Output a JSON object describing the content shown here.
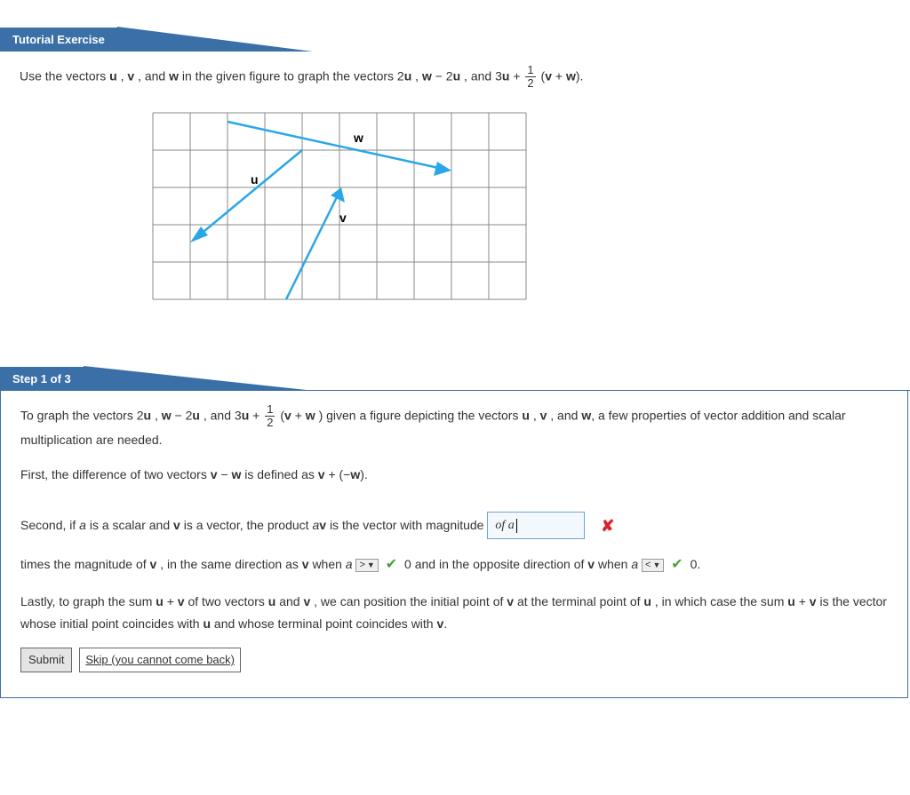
{
  "exercise": {
    "tab_label": "Tutorial Exercise",
    "prompt_pre": "Use the vectors  ",
    "u": "u",
    "v": "v",
    "w": "w",
    "prompt_mid1": ",   ",
    "prompt_mid2": ",  and  ",
    "prompt_mid3": "  in the given figure to graph the vectors  2",
    "prompt_mid4": ",   ",
    "prompt_mid5": " − 2",
    "prompt_mid6": ",  and  3",
    "prompt_mid7": " + ",
    "frac_num": "1",
    "frac_den": "2",
    "prompt_mid8": "(",
    "prompt_mid9": " + ",
    "prompt_end": ")."
  },
  "figure": {
    "label_u": "u",
    "label_v": "v",
    "label_w": "w"
  },
  "step": {
    "tab_label": "Step 1 of 3",
    "p1a": "To graph the vectors  2",
    "p1b": ",   ",
    "p1c": " − 2",
    "p1d": ",  and  3",
    "p1e": " + ",
    "p1f": "(",
    "p1g": " + ",
    "p1h": ")  given a figure depicting the vectors  ",
    "p1i": ",   ",
    "p1j": ",  and ",
    "p1k": ",  a few properties of vector addition and scalar multiplication are needed.",
    "p2a": "First, the difference of two vectors  ",
    "p2b": " − ",
    "p2c": "  is defined as  ",
    "p2d": " + (−",
    "p2e": ").",
    "p3a": "Second, if ",
    "p3a_it": "a",
    "p3b": " is a scalar and  ",
    "p3c": "  is a vector, the product  ",
    "p3c_it": "a",
    "p3d": "  is the vector with magnitude",
    "answer_text": "of a",
    "p4a": "times the magnitude of  ",
    "p4b": ",  in the same direction as  ",
    "p4c": "  when  ",
    "p4c_it": "a",
    "select1": ">",
    "p4d": "0 and in the opposite direction of ",
    "p4e": "  when  ",
    "p4e_it": "a",
    "select2": "<",
    "p4f": "0.",
    "p5a": "Lastly, to graph the sum  ",
    "p5b": " + ",
    "p5c": "  of two vectors  ",
    "p5d": "  and  ",
    "p5e": ",  we can position the initial point of  ",
    "p5f": "  at the terminal point of  ",
    "p5g": ",  in which case the sum  ",
    "p5h": " + ",
    "p5i": "  is the vector whose initial point coincides with  ",
    "p5j": "  and whose terminal point coincides with  ",
    "p5k": ".",
    "submit_label": "Submit",
    "skip_label": "Skip (you cannot come back)"
  }
}
